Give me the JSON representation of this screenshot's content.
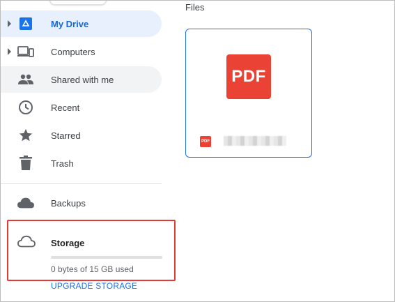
{
  "sidebar": {
    "items": [
      {
        "label": "My Drive",
        "icon": "drive-icon",
        "active": true,
        "expandable": true
      },
      {
        "label": "Computers",
        "icon": "computers-icon",
        "active": false,
        "expandable": true
      },
      {
        "label": "Shared with me",
        "icon": "people-icon",
        "active": false,
        "expandable": false
      },
      {
        "label": "Recent",
        "icon": "clock-icon",
        "active": false,
        "expandable": false
      },
      {
        "label": "Starred",
        "icon": "star-icon",
        "active": false,
        "expandable": false
      },
      {
        "label": "Trash",
        "icon": "trash-icon",
        "active": false,
        "expandable": false
      },
      {
        "label": "Backups",
        "icon": "cloud-filled-icon",
        "active": false,
        "expandable": false
      }
    ],
    "storage": {
      "label": "Storage",
      "icon": "cloud-outline-icon",
      "used_text": "0 bytes of 15 GB used",
      "used_fraction": 0,
      "upgrade_label": "UPGRADE STORAGE"
    }
  },
  "main": {
    "section_title": "Files",
    "files": [
      {
        "thumb_text": "PDF",
        "type_badge": "PDF",
        "name": ""
      }
    ]
  },
  "colors": {
    "accent": "#1a73e8",
    "active_bg": "#e8f0fe",
    "active_text": "#1967d2",
    "pdf_red": "#ea4335",
    "highlight_box": "#e53935"
  }
}
